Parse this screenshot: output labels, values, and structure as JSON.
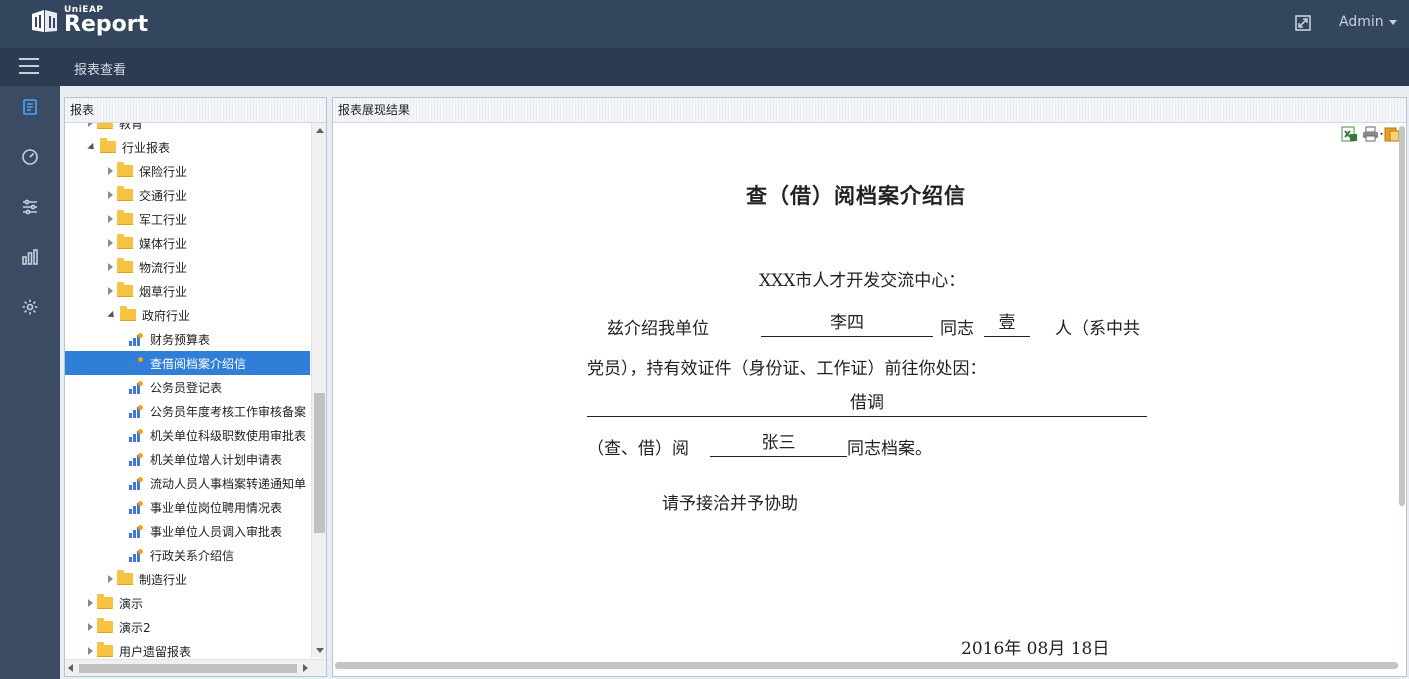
{
  "app": {
    "logo_small": "UniEAP",
    "logo_big": "Report",
    "user": "Admin"
  },
  "breadcrumb": "报表查看",
  "icon_sidebar": [
    "report-icon",
    "dashboard-icon",
    "sliders-icon",
    "bar-chart-icon",
    "settings-icon"
  ],
  "tree_panel": {
    "title": "报表",
    "items": [
      {
        "label": "教育",
        "type": "folder",
        "level": 1,
        "state": "closed"
      },
      {
        "label": "行业报表",
        "type": "folder",
        "level": 1,
        "state": "open"
      },
      {
        "label": "保险行业",
        "type": "folder",
        "level": 2,
        "state": "closed"
      },
      {
        "label": "交通行业",
        "type": "folder",
        "level": 2,
        "state": "closed"
      },
      {
        "label": "军工行业",
        "type": "folder",
        "level": 2,
        "state": "closed"
      },
      {
        "label": "媒体行业",
        "type": "folder",
        "level": 2,
        "state": "closed"
      },
      {
        "label": "物流行业",
        "type": "folder",
        "level": 2,
        "state": "closed"
      },
      {
        "label": "烟草行业",
        "type": "folder",
        "level": 2,
        "state": "closed"
      },
      {
        "label": "政府行业",
        "type": "folder",
        "level": 2,
        "state": "open"
      },
      {
        "label": "财务预算表",
        "type": "report",
        "level": 3
      },
      {
        "label": "查借阅档案介绍信",
        "type": "report",
        "level": 3,
        "selected": true
      },
      {
        "label": "公务员登记表",
        "type": "report",
        "level": 3
      },
      {
        "label": "公务员年度考核工作审核备案",
        "type": "report",
        "level": 3
      },
      {
        "label": "机关单位科级职数使用审批表",
        "type": "report",
        "level": 3
      },
      {
        "label": "机关单位增人计划申请表",
        "type": "report",
        "level": 3
      },
      {
        "label": "流动人员人事档案转递通知单",
        "type": "report",
        "level": 3
      },
      {
        "label": "事业单位岗位聘用情况表",
        "type": "report",
        "level": 3
      },
      {
        "label": "事业单位人员调入审批表",
        "type": "report",
        "level": 3
      },
      {
        "label": "行政关系介绍信",
        "type": "report",
        "level": 3
      },
      {
        "label": "制造行业",
        "type": "folder",
        "level": 2,
        "state": "closed"
      },
      {
        "label": "演示",
        "type": "folder",
        "level": 1,
        "state": "closed"
      },
      {
        "label": "演示2",
        "type": "folder",
        "level": 1,
        "state": "closed"
      },
      {
        "label": "用户遗留报表",
        "type": "folder",
        "level": 1,
        "state": "closed"
      }
    ]
  },
  "report_panel": {
    "title": "报表展现结果",
    "tools": [
      "excel-export-icon",
      "print-icon",
      "export-menu-icon"
    ],
    "doc": {
      "title": "查（借）阅档案介绍信",
      "salutation": "XXX市人才开发交流中心：",
      "line1_pre": "兹介绍我单位",
      "person": "李四",
      "line1_mid": "同志",
      "count": "壹",
      "line1_post": "人（系中共",
      "line2": "党员），持有效证件（身份证、工作证）前往你处因：",
      "reason": "借调",
      "line3_pre": "（查、借）阅",
      "target": "张三",
      "line3_post": "同志档案。",
      "closing": "请予接洽并予协助",
      "date": "2016年  08月  18日"
    }
  }
}
